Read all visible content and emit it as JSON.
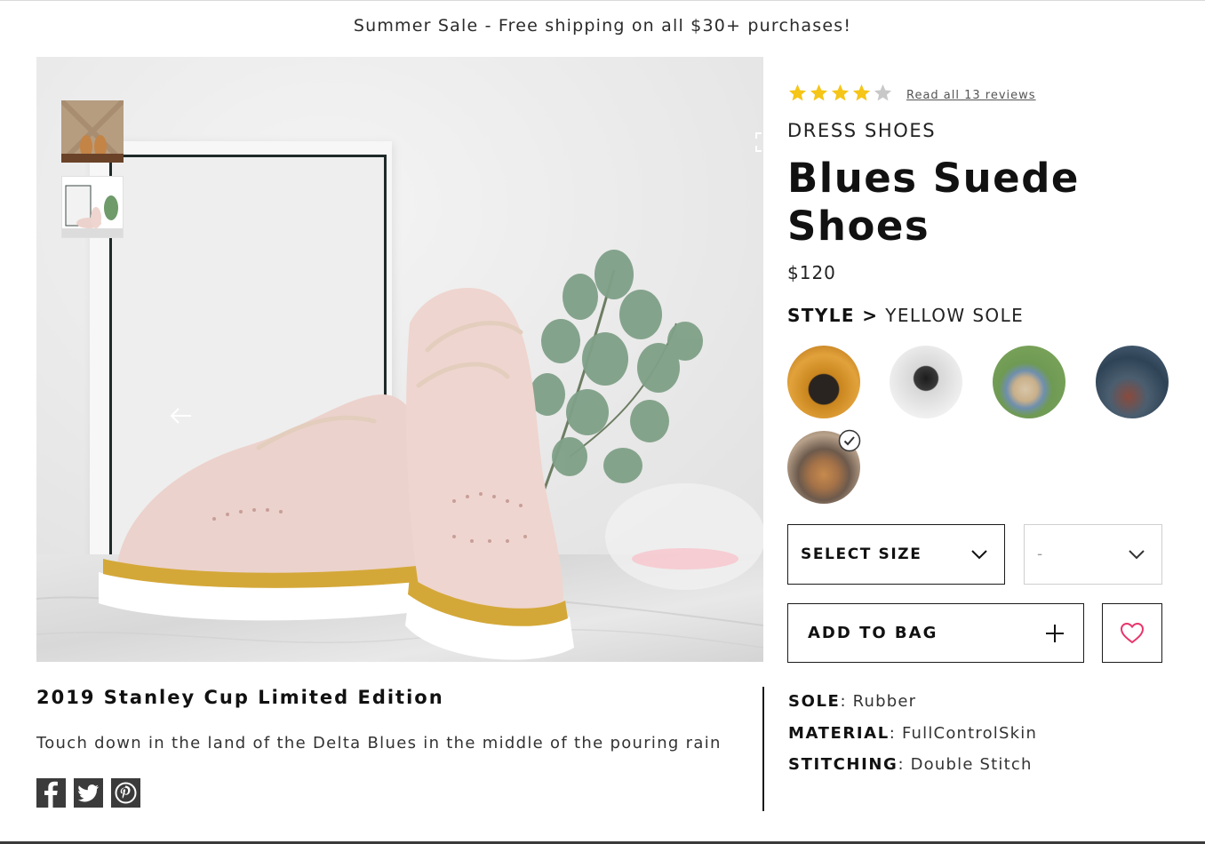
{
  "promo_banner": {
    "text": "Summer Sale - Free shipping on all $30+ purchases!"
  },
  "gallery": {
    "thumbnails": [
      "thumbnail-1",
      "thumbnail-2"
    ],
    "icons": {
      "expand": "expand-icon",
      "previous": "arrow-left-icon"
    }
  },
  "product": {
    "rating": 4,
    "rating_max": 5,
    "reviews_link": "Read all 13 reviews",
    "category": "DRESS SHOES",
    "title": "Blues Suede Shoes",
    "price": "$120",
    "style_label": "STYLE >",
    "style_value": "YELLOW SOLE",
    "selected_swatch_index": 4,
    "size_select": {
      "label": "SELECT SIZE"
    },
    "qty_select": {
      "value": "-"
    },
    "add_to_bag": "ADD TO BAG",
    "edition_title": "2019 Stanley Cup Limited Edition",
    "description": "Touch down in the land of the Delta Blues in the middle of the pouring rain",
    "specs": [
      {
        "label": "SOLE",
        "value": ": Rubber"
      },
      {
        "label": "MATERIAL",
        "value": ": FullControlSkin"
      },
      {
        "label": "STITCHING",
        "value": ": Double Stitch"
      }
    ]
  },
  "social": [
    "facebook-icon",
    "twitter-icon",
    "pinterest-icon"
  ],
  "colors": {
    "star": "#f5c518",
    "star_empty": "#c8c8c8",
    "heart": "#e8356b",
    "text": "#111111"
  }
}
